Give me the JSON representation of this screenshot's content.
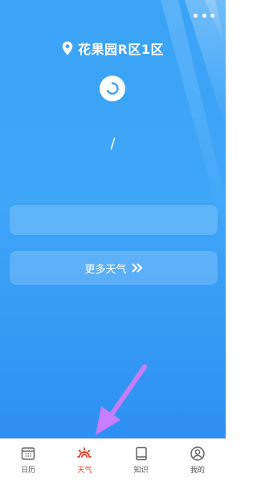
{
  "header": {
    "location": "花果园R区1区",
    "more_icon": "more-dots-icon"
  },
  "weather": {
    "status_icon": "loading-icon",
    "temperature_separator": "/"
  },
  "actions": {
    "more_weather_label": "更多天气",
    "more_weather_icon": "double-chevron-right-icon"
  },
  "tabbar": {
    "items": [
      {
        "label": "日历",
        "icon": "calendar-icon",
        "active": false
      },
      {
        "label": "天气",
        "icon": "weather-sun-icon",
        "active": true
      },
      {
        "label": "知识",
        "icon": "book-icon",
        "active": false
      },
      {
        "label": "我的",
        "icon": "profile-icon",
        "active": false
      }
    ]
  },
  "colors": {
    "background_top": "#3aa3f6",
    "background_bottom": "#2e8ff2",
    "active_tab": "#e23c2c",
    "annotation_arrow": "#c77dff"
  }
}
